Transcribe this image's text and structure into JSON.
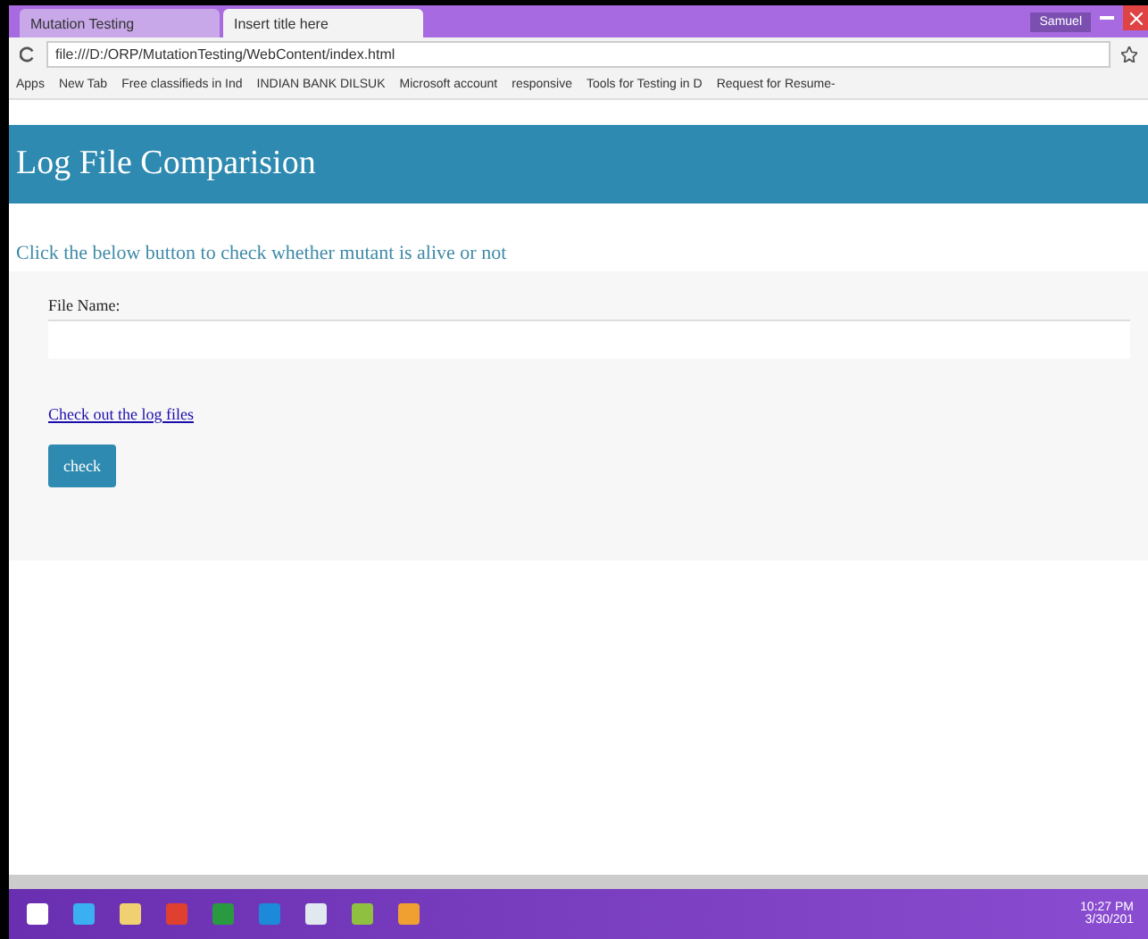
{
  "browser": {
    "tabs": [
      {
        "title": "Mutation Testing",
        "selected": false
      },
      {
        "title": "Insert title here",
        "selected": true
      }
    ],
    "user": "Samuel",
    "url": "file:///D:/ORP/MutationTesting/WebContent/index.html",
    "bookmarks": [
      "Apps",
      "New Tab",
      "Free classifieds in Ind",
      "INDIAN BANK DILSUK",
      "Microsoft account",
      "responsive",
      "Tools for Testing in D",
      "Request for Resume-"
    ]
  },
  "page": {
    "title": "Log File Comparision",
    "instruction": "Click the below button to check whether mutant is alive or not",
    "field_label": "File Name:",
    "link": "Check out the log files",
    "button": "check"
  },
  "taskbar": {
    "time": "10:27 PM",
    "date": "3/30/201"
  }
}
